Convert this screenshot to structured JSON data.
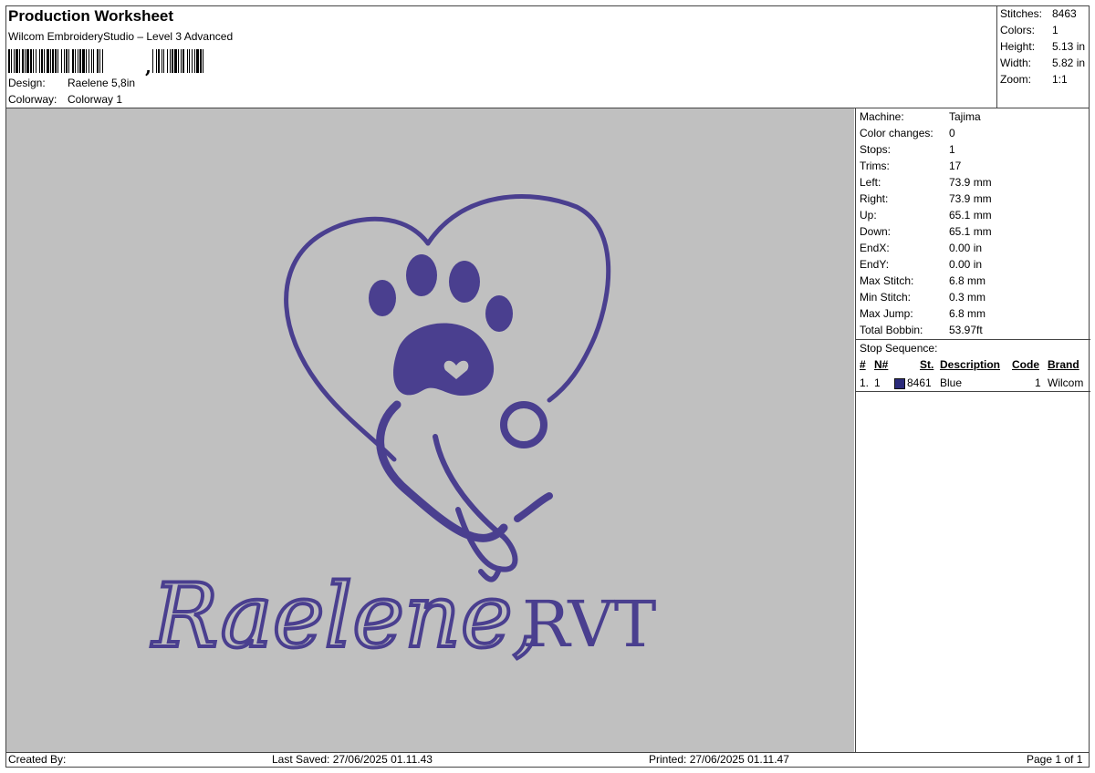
{
  "header": {
    "title": "Production Worksheet",
    "subtitle": "Wilcom EmbroideryStudio – Level 3 Advanced",
    "design_label": "Design:",
    "design_value": "Raelene 5,8in",
    "colorway_label": "Colorway:",
    "colorway_value": "Colorway 1"
  },
  "stats": [
    {
      "label": "Stitches:",
      "value": "8463"
    },
    {
      "label": "Colors:",
      "value": "1"
    },
    {
      "label": "Height:",
      "value": "5.13 in"
    },
    {
      "label": "Width:",
      "value": "5.82 in"
    },
    {
      "label": "Zoom:",
      "value": "1:1"
    }
  ],
  "machine_info": [
    {
      "label": "Machine:",
      "value": "Tajima"
    },
    {
      "label": "Color changes:",
      "value": "0"
    },
    {
      "label": "Stops:",
      "value": "1"
    },
    {
      "label": "Trims:",
      "value": "17"
    },
    {
      "label": "Left:",
      "value": "73.9 mm"
    },
    {
      "label": "Right:",
      "value": "73.9 mm"
    },
    {
      "label": "Up:",
      "value": "65.1 mm"
    },
    {
      "label": "Down:",
      "value": "65.1 mm"
    },
    {
      "label": "EndX:",
      "value": "0.00 in"
    },
    {
      "label": "EndY:",
      "value": "0.00 in"
    },
    {
      "label": "Max Stitch:",
      "value": "6.8 mm"
    },
    {
      "label": "Min Stitch:",
      "value": "0.3 mm"
    },
    {
      "label": "Max Jump:",
      "value": "6.8 mm"
    },
    {
      "label": "Total Bobbin:",
      "value": "53.97ft"
    }
  ],
  "stop_sequence": {
    "title": "Stop Sequence:",
    "columns": {
      "hash": "#",
      "n": "N#",
      "st": "St.",
      "description": "Description",
      "code": "Code",
      "brand": "Brand"
    },
    "rows": [
      {
        "hash": "1.",
        "n": "1",
        "st": "8461",
        "description": "Blue",
        "code": "1",
        "brand": "Wilcom",
        "color": "#2a2a7a"
      }
    ]
  },
  "design_preview": {
    "text_script": "Raelene,",
    "text_serif": "RVT",
    "thread_color": "#4a3f8f",
    "background_color": "#c0c0c0"
  },
  "footer": {
    "created_by": "Created By:",
    "last_saved": "Last Saved: 27/06/2025 01.11.43",
    "printed": "Printed: 27/06/2025 01.11.47",
    "page": "Page 1 of 1"
  }
}
